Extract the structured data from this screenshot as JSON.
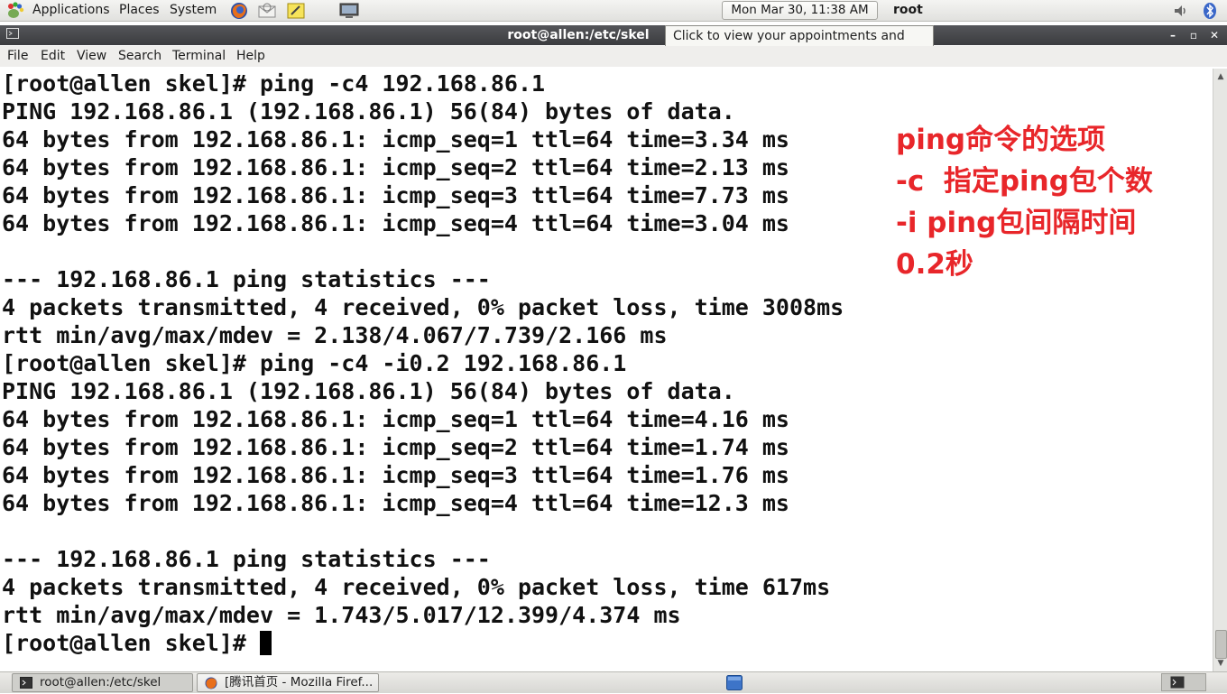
{
  "top_panel": {
    "menus": [
      "Applications",
      "Places",
      "System"
    ],
    "clock": "Mon Mar 30, 11:38 AM",
    "user": "root",
    "launchers": [
      "firefox-icon",
      "mail-icon",
      "notes-icon",
      "monitor-icon"
    ],
    "tray": [
      "volume-icon",
      "bluetooth-icon"
    ]
  },
  "window": {
    "title": "root@allen:/etc/skel",
    "tooltip": "Click to view your appointments and tasks"
  },
  "menubar": [
    "File",
    "Edit",
    "View",
    "Search",
    "Terminal",
    "Help"
  ],
  "terminal": {
    "lines": [
      "[root@allen skel]# ping -c4 192.168.86.1",
      "PING 192.168.86.1 (192.168.86.1) 56(84) bytes of data.",
      "64 bytes from 192.168.86.1: icmp_seq=1 ttl=64 time=3.34 ms",
      "64 bytes from 192.168.86.1: icmp_seq=2 ttl=64 time=2.13 ms",
      "64 bytes from 192.168.86.1: icmp_seq=3 ttl=64 time=7.73 ms",
      "64 bytes from 192.168.86.1: icmp_seq=4 ttl=64 time=3.04 ms",
      "",
      "--- 192.168.86.1 ping statistics ---",
      "4 packets transmitted, 4 received, 0% packet loss, time 3008ms",
      "rtt min/avg/max/mdev = 2.138/4.067/7.739/2.166 ms",
      "[root@allen skel]# ping -c4 -i0.2 192.168.86.1",
      "PING 192.168.86.1 (192.168.86.1) 56(84) bytes of data.",
      "64 bytes from 192.168.86.1: icmp_seq=1 ttl=64 time=4.16 ms",
      "64 bytes from 192.168.86.1: icmp_seq=2 ttl=64 time=1.74 ms",
      "64 bytes from 192.168.86.1: icmp_seq=3 ttl=64 time=1.76 ms",
      "64 bytes from 192.168.86.1: icmp_seq=4 ttl=64 time=12.3 ms",
      "",
      "--- 192.168.86.1 ping statistics ---",
      "4 packets transmitted, 4 received, 0% packet loss, time 617ms",
      "rtt min/avg/max/mdev = 1.743/5.017/12.399/4.374 ms"
    ],
    "prompt": "[root@allen skel]# "
  },
  "annotation": {
    "lines": [
      "ping命令的选项",
      "-c  指定ping包个数",
      "-i ping包间隔时间",
      "0.2秒"
    ],
    "color": "#e8262a"
  },
  "taskbar": {
    "items": [
      "root@allen:/etc/skel",
      "[腾讯首页 - Mozilla Firef..."
    ]
  }
}
